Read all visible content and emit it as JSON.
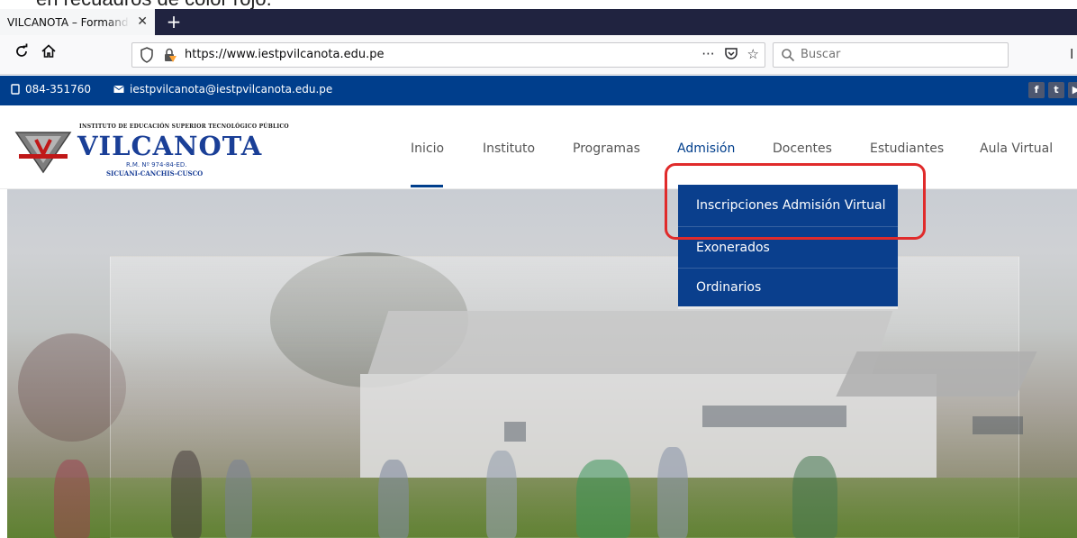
{
  "caption": "en recuadros de color rojo.",
  "browser": {
    "tab_title": "VILCANOTA – Formando",
    "tab_close": "✕",
    "new_tab": "+",
    "url": "https://www.iestpvilcanota.edu.pe",
    "url_actions": [
      "···",
      "☆"
    ],
    "search_placeholder": "Buscar"
  },
  "topbar": {
    "phone": "084-351760",
    "email": "iestpvilcanota@iestpvilcanota.edu.pe",
    "social": [
      "f",
      "t",
      "▶"
    ]
  },
  "logo": {
    "tagline": "INSTITUTO DE EDUCACIÓN SUPERIOR TECNOLÓGICO PÚBLICO",
    "name": "VILCANOTA",
    "rm": "R.M. Nº 974-84-ED.",
    "place": "SICUANI-CANCHIS-CUSCO"
  },
  "menu": {
    "items": [
      "Inicio",
      "Instituto",
      "Programas",
      "Admisión",
      "Docentes",
      "Estudiantes",
      "Aula Virtual"
    ],
    "active": "Admisión"
  },
  "dropdown": {
    "items": [
      "Inscripciones Admisión Virtual",
      "Exonerados",
      "Ordinarios"
    ]
  },
  "colors": {
    "brand_blue": "#003e8c",
    "dropdown_blue": "#0a3f8d",
    "highlight_red": "#e02b2b"
  }
}
